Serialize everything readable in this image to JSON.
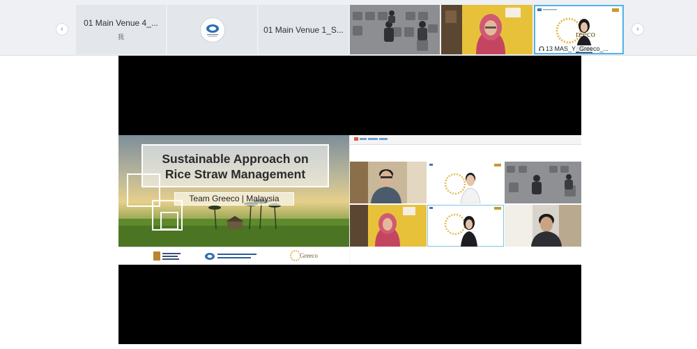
{
  "strip": {
    "prev_label": "‹",
    "next_label": "›",
    "tiles": [
      {
        "name": "01 Main Venue 4_...",
        "sub": "我"
      },
      {
        "name": "",
        "sub": ""
      },
      {
        "name": "01 Main Venue 1_S...",
        "sub": ""
      },
      {
        "name": "",
        "sub": ""
      },
      {
        "name": "",
        "sub": ""
      },
      {
        "name": "13 MAS_Y_Greeco_...",
        "sub": ""
      }
    ]
  },
  "presentation": {
    "title_line1": "Sustainable Approach on",
    "title_line2": "Rice Straw Management",
    "team": "Team Greeco | Malaysia",
    "footer_brand": "Greeco"
  },
  "colors": {
    "active_border": "#4fb3e8",
    "strip_bg": "#eef0f3",
    "stage_bg": "#000000"
  }
}
